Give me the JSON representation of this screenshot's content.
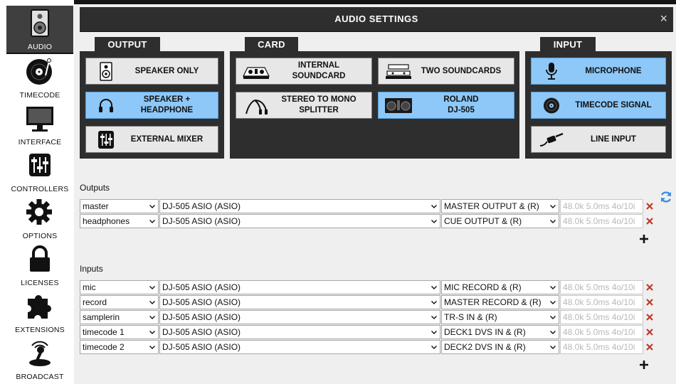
{
  "sidebar": {
    "items": [
      {
        "label": "AUDIO",
        "icon": "speaker-icon",
        "active": true
      },
      {
        "label": "TIMECODE",
        "icon": "vinyl-record-icon"
      },
      {
        "label": "INTERFACE",
        "icon": "monitor-icon"
      },
      {
        "label": "CONTROLLERS",
        "icon": "faders-icon"
      },
      {
        "label": "OPTIONS",
        "icon": "gear-icon"
      },
      {
        "label": "LICENSES",
        "icon": "lock-icon"
      },
      {
        "label": "EXTENSIONS",
        "icon": "puzzle-icon"
      },
      {
        "label": "BROADCAST",
        "icon": "broadcast-icon"
      }
    ]
  },
  "header": {
    "title": "AUDIO SETTINGS",
    "close_symbol": "×"
  },
  "groups": {
    "output": {
      "label": "OUTPUT",
      "options": [
        {
          "label": "SPEAKER ONLY",
          "icon": "speaker-icon",
          "selected": false
        },
        {
          "label": "SPEAKER +\nHEADPHONE",
          "icon": "headphones-icon",
          "selected": true
        },
        {
          "label": "EXTERNAL MIXER",
          "icon": "mixer-icon",
          "selected": false
        }
      ]
    },
    "card": {
      "label": "CARD",
      "options": [
        {
          "label": "INTERNAL\nSOUNDCARD",
          "icon": "dj-controller-icon",
          "selected": false
        },
        {
          "label": "TWO SOUNDCARDS",
          "icon": "soundcards-icon",
          "selected": false
        },
        {
          "label": "STEREO TO MONO\nSPLITTER",
          "icon": "splitter-cable-icon",
          "selected": false
        },
        {
          "label": "ROLAND\nDJ-505",
          "icon": "roland-controller-icon",
          "selected": true
        }
      ]
    },
    "input": {
      "label": "INPUT",
      "options": [
        {
          "label": "MICROPHONE",
          "icon": "microphone-icon",
          "selected": true
        },
        {
          "label": "TIMECODE SIGNAL",
          "icon": "timecode-disc-icon",
          "selected": true
        },
        {
          "label": "LINE INPUT",
          "icon": "line-cable-icon",
          "selected": false
        }
      ]
    }
  },
  "outputs": {
    "label": "Outputs",
    "rows": [
      {
        "name": "master",
        "device": "DJ-505 ASIO (ASIO)",
        "channel": "MASTER OUTPUT & (R)",
        "info": "48.0k 5.0ms 4o/10i"
      },
      {
        "name": "headphones",
        "device": "DJ-505 ASIO (ASIO)",
        "channel": "CUE OUTPUT & (R)",
        "info": "48.0k 5.0ms 4o/10i"
      }
    ]
  },
  "inputs": {
    "label": "Inputs",
    "rows": [
      {
        "name": "mic",
        "device": "DJ-505 ASIO (ASIO)",
        "channel": "MIC RECORD & (R)",
        "info": "48.0k 5.0ms 4o/10i"
      },
      {
        "name": "record",
        "device": "DJ-505 ASIO (ASIO)",
        "channel": "MASTER RECORD & (R)",
        "info": "48.0k 5.0ms 4o/10i"
      },
      {
        "name": "samplerin",
        "device": "DJ-505 ASIO (ASIO)",
        "channel": "TR-S IN & (R)",
        "info": "48.0k 5.0ms 4o/10i"
      },
      {
        "name": "timecode 1",
        "device": "DJ-505 ASIO (ASIO)",
        "channel": "DECK1 DVS IN & (R)",
        "info": "48.0k 5.0ms 4o/10i"
      },
      {
        "name": "timecode 2",
        "device": "DJ-505 ASIO (ASIO)",
        "channel": "DECK2 DVS IN & (R)",
        "info": "48.0k 5.0ms 4o/10i"
      }
    ]
  },
  "colors": {
    "selected": "#8dc8f8",
    "panel": "#2e2e2e",
    "remove": "#c0392b"
  }
}
